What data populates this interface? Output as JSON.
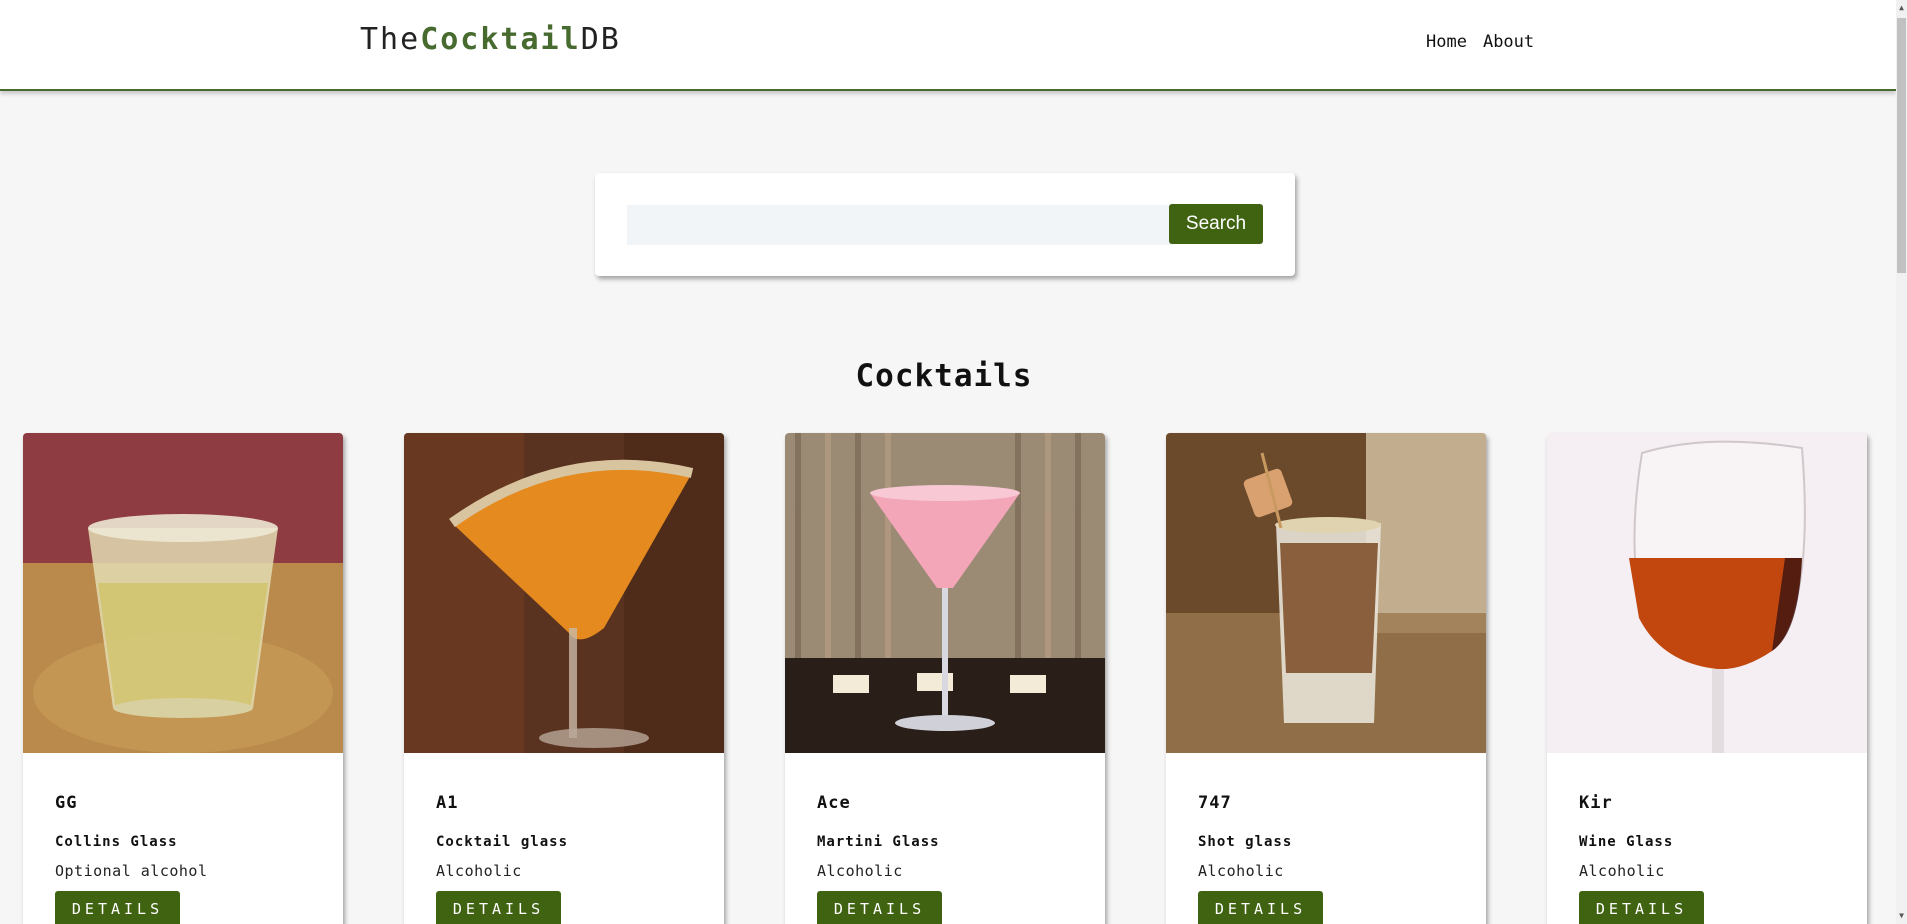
{
  "header": {
    "logo_prefix": "The",
    "logo_accent": "Cocktail",
    "logo_suffix": "DB",
    "nav": [
      {
        "label": "Home"
      },
      {
        "label": "About"
      }
    ]
  },
  "search": {
    "value": "",
    "placeholder": "",
    "button_label": "Search"
  },
  "main": {
    "section_title": "Cocktails",
    "cocktails": [
      {
        "name": "GG",
        "glass": "Collins Glass",
        "info": "Optional alcohol",
        "button_label": "DETAILS",
        "image": "tumbler-glass-photo"
      },
      {
        "name": "A1",
        "glass": "Cocktail glass",
        "info": "Alcoholic",
        "button_label": "DETAILS",
        "image": "orange-martini-photo"
      },
      {
        "name": "Ace",
        "glass": "Martini Glass",
        "info": "Alcoholic",
        "button_label": "DETAILS",
        "image": "pink-martini-photo"
      },
      {
        "name": "747",
        "glass": "Shot glass",
        "info": "Alcoholic",
        "button_label": "DETAILS",
        "image": "shot-glass-photo"
      },
      {
        "name": "Kir",
        "glass": "Wine Glass",
        "info": "Alcoholic",
        "button_label": "DETAILS",
        "image": "wine-glass-photo"
      }
    ]
  },
  "colors": {
    "accent": "#406312",
    "nav_border": "#476a2e",
    "background": "#f6f6f6"
  }
}
